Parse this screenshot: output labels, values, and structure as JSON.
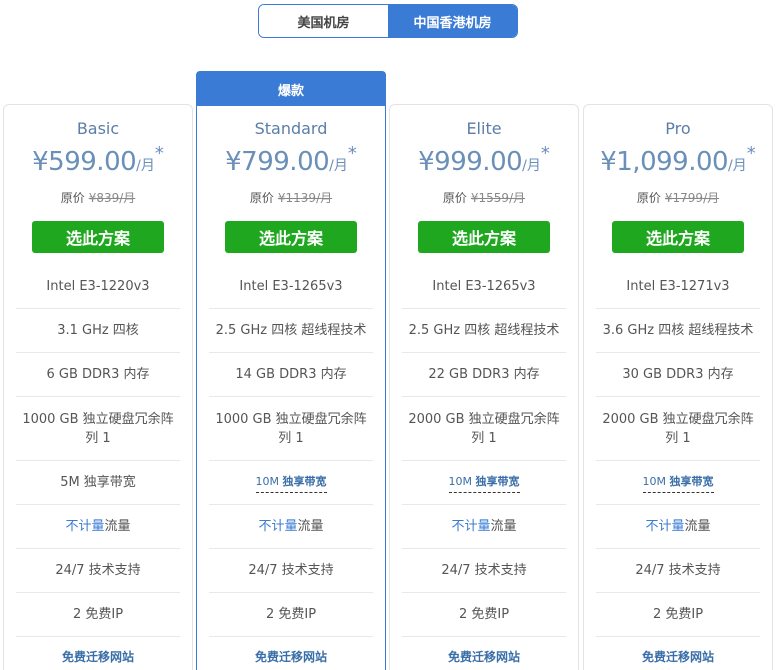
{
  "tabs": [
    {
      "label": "美国机房",
      "active": false
    },
    {
      "label": "中国香港机房",
      "active": true
    }
  ],
  "featured_badge": "爆款",
  "plans": [
    {
      "name": "Basic",
      "currency": "¥",
      "price": "599.00",
      "per": "/月",
      "star": "*",
      "orig_label": "原价",
      "orig_price": "¥839/月",
      "button": "选此方案",
      "cpu": "Intel E3-1220v3",
      "freq": "3.1 GHz 四核",
      "ram": "6 GB DDR3 内存",
      "disk": "1000 GB 独立硬盘冗余阵列 1",
      "bandwidth": "5M 独享带宽",
      "traffic_hl": "不计量",
      "traffic": " 流量",
      "support": "24/7 技术支持",
      "ip": "2 免费IP",
      "migrate": "免费迁移网站"
    },
    {
      "name": "Standard",
      "currency": "¥",
      "price": "799.00",
      "per": "/月",
      "star": "*",
      "orig_label": "原价",
      "orig_price": "¥1139/月",
      "button": "选此方案",
      "cpu": "Intel E3-1265v3",
      "freq": "2.5 GHz 四核 超线程技术",
      "ram": "14 GB DDR3 内存",
      "disk": "1000 GB 独立硬盘冗余阵列 1",
      "bandwidth_num": "10M",
      "bandwidth_label": "独享带宽",
      "traffic_hl": "不计量",
      "traffic": " 流量",
      "support": "24/7 技术支持",
      "ip": "2 免费IP",
      "migrate": "免费迁移网站"
    },
    {
      "name": "Elite",
      "currency": "¥",
      "price": "999.00",
      "per": "/月",
      "star": "*",
      "orig_label": "原价",
      "orig_price": "¥1559/月",
      "button": "选此方案",
      "cpu": "Intel E3-1265v3",
      "freq": "2.5 GHz 四核 超线程技术",
      "ram": "22 GB DDR3 内存",
      "disk": "2000 GB 独立硬盘冗余阵列 1",
      "bandwidth_num": "10M",
      "bandwidth_label": "独享带宽",
      "traffic_hl": "不计量",
      "traffic": " 流量",
      "support": "24/7 技术支持",
      "ip": "2 免费IP",
      "migrate": "免费迁移网站"
    },
    {
      "name": "Pro",
      "currency": "¥",
      "price": "1,099.00",
      "per": "/月",
      "star": "*",
      "orig_label": "原价",
      "orig_price": "¥1799/月",
      "button": "选此方案",
      "cpu": "Intel E3-1271v3",
      "freq": "3.6 GHz 四核 超线程技术",
      "ram": "30 GB DDR3 内存",
      "disk": "2000 GB 独立硬盘冗余阵列 1",
      "bandwidth_num": "10M",
      "bandwidth_label": "独享带宽",
      "traffic_hl": "不计量",
      "traffic": " 流量",
      "support": "24/7 技术支持",
      "ip": "2 免费IP",
      "migrate": "免费迁移网站"
    }
  ],
  "colors": {
    "accent": "#3a7bd5",
    "button_green": "#1fa81f",
    "price_blue": "#6a8fb8"
  }
}
